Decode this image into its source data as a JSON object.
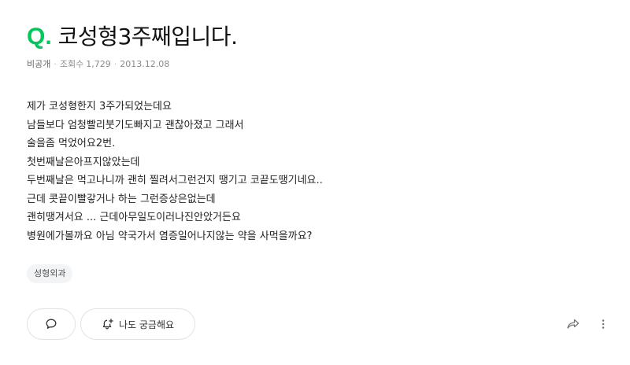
{
  "question": {
    "mark": "Q.",
    "title": "코성형3주째입니다.",
    "meta": {
      "privacy": "비공개",
      "views_label": "조회수",
      "views": "1,729",
      "date": "2013.12.08"
    },
    "body_lines": [
      " 제가 코성형한지 3주가되었는데요",
      "남들보다 엄청빨리붓기도빠지고 괜찮아졌고 그래서",
      "술을좀 먹었어요2번.",
      "첫번째날은아프지않았는데",
      "두번째날은 먹고나니까 괜히 찔려서그런건지 땡기고 코끝도땡기네요..",
      "근데 콧끝이빨갛거나 하는 그런증상은없는데",
      "괜히땡겨서요 ... 근데아무일도이러나진안았거든요",
      "병원에가볼까요 아님 약국가서 염증일어나지않는 약을 사먹을까요?"
    ],
    "tags": [
      "성형외과"
    ]
  },
  "actions": {
    "curious_label": "나도 궁금해요",
    "comment_icon": "speech-bubble-icon",
    "curious_icon": "bell-plus-icon",
    "share_icon": "share-icon",
    "more_icon": "more-vertical-icon"
  },
  "colors": {
    "accent": "#03c75a",
    "text": "#222222",
    "meta": "#8a8a8a",
    "tag_bg": "#f3f4f6"
  }
}
